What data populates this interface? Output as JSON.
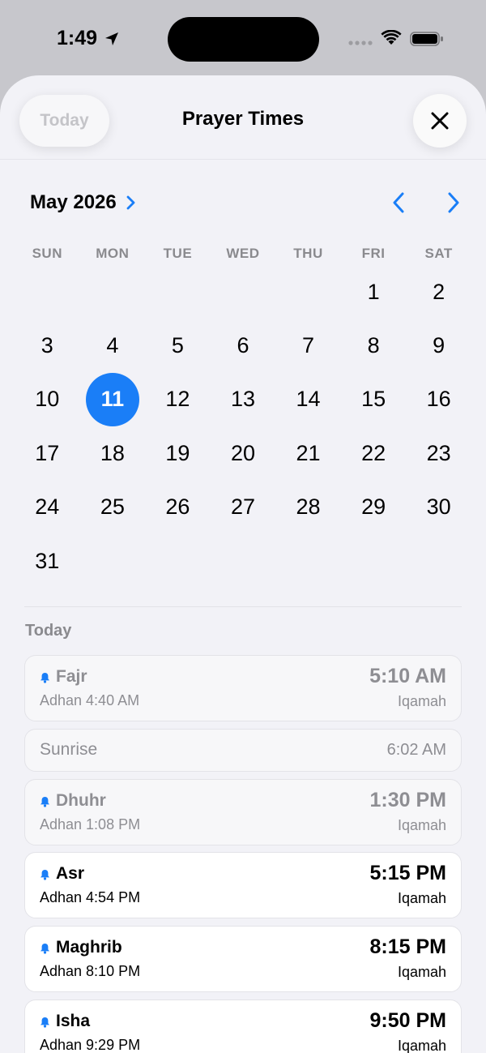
{
  "status_bar": {
    "time": "1:49",
    "icons": [
      "location-arrow-icon",
      "cellular-dots-icon",
      "wifi-icon",
      "battery-icon"
    ]
  },
  "nav": {
    "today_label": "Today",
    "title": "Prayer Times",
    "close_icon": "close-icon"
  },
  "calendar": {
    "month_label": "May 2026",
    "weekdays": [
      "SUN",
      "MON",
      "TUE",
      "WED",
      "THU",
      "FRI",
      "SAT"
    ],
    "leading_blanks": 5,
    "days": [
      "1",
      "2",
      "3",
      "4",
      "5",
      "6",
      "7",
      "8",
      "9",
      "10",
      "11",
      "12",
      "13",
      "14",
      "15",
      "16",
      "17",
      "18",
      "19",
      "20",
      "21",
      "22",
      "23",
      "24",
      "25",
      "26",
      "27",
      "28",
      "29",
      "30",
      "31"
    ],
    "selected_day": "11",
    "accent_color": "#1a7ef7"
  },
  "section": {
    "label": "Today"
  },
  "prayers": [
    {
      "name": "Fajr",
      "adhan": "Adhan 4:40 AM",
      "time": "5:10 AM",
      "iqamah": "Iqamah",
      "passed": true,
      "bell": true
    },
    {
      "name": "Sunrise",
      "time": "6:02 AM",
      "passed": true,
      "bell": false
    },
    {
      "name": "Dhuhr",
      "adhan": "Adhan 1:08 PM",
      "time": "1:30 PM",
      "iqamah": "Iqamah",
      "passed": true,
      "bell": true
    },
    {
      "name": "Asr",
      "adhan": "Adhan 4:54 PM",
      "time": "5:15 PM",
      "iqamah": "Iqamah",
      "passed": false,
      "bell": true
    },
    {
      "name": "Maghrib",
      "adhan": "Adhan 8:10 PM",
      "time": "8:15 PM",
      "iqamah": "Iqamah",
      "passed": false,
      "bell": true
    },
    {
      "name": "Isha",
      "adhan": "Adhan 9:29 PM",
      "time": "9:50 PM",
      "iqamah": "Iqamah",
      "passed": false,
      "bell": true
    }
  ]
}
